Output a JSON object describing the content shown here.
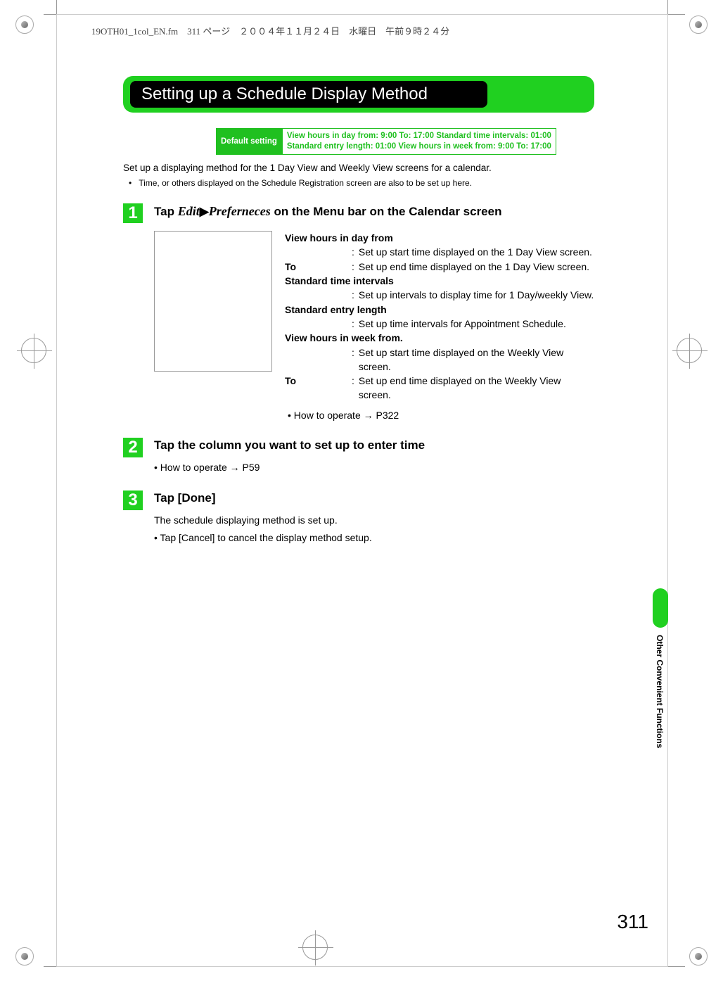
{
  "runhead": "19OTH01_1col_EN.fm　311 ページ　２００４年１１月２４日　水曜日　午前９時２４分",
  "title": "Setting up a Schedule Display Method",
  "default_setting": {
    "label": "Default setting",
    "value_line1": "View hours in day from: 9:00 To: 17:00 Standard time intervals: 01:00",
    "value_line2": "Standard entry length: 01:00 View hours in week from: 9:00 To: 17:00"
  },
  "intro": "Set up a displaying method for the 1 Day View and Weekly View screens for a calendar.",
  "intro_bullet": "Time, or others displayed on the Schedule Registration screen are also to be set up here.",
  "steps": {
    "s1": {
      "num": "1",
      "title_pre": "Tap ",
      "title_edit": "Edit",
      "title_arrow": "▶",
      "title_pref": "Preferneces",
      "title_post": " on the Menu bar on the Calendar screen",
      "defs": {
        "d1": {
          "label": "View hours in day from",
          "desc": "Set up start time displayed on the 1 Day View screen."
        },
        "d2": {
          "label": "To",
          "desc": "Set up end time displayed on the 1 Day View screen."
        },
        "d3": {
          "label": "Standard time intervals",
          "desc": "Set up intervals to display time for 1 Day/weekly View."
        },
        "d4": {
          "label": "Standard entry length",
          "desc": "Set up time intervals for Appointment Schedule."
        },
        "d5": {
          "label": "View hours in week from.",
          "desc": "Set up start time displayed on the Weekly View screen."
        },
        "d6": {
          "label": "To",
          "desc": "Set up end time displayed on the Weekly View screen."
        }
      },
      "howto": "•   How to operate → P322"
    },
    "s2": {
      "num": "2",
      "title": "Tap the column you want to set up to enter time",
      "howto": "•   How to operate → P59"
    },
    "s3": {
      "num": "3",
      "title": "Tap [Done]",
      "text": "The schedule displaying method is set up.",
      "bullet": "•   Tap [Cancel] to cancel the display method setup."
    }
  },
  "side_tab": "Other Convenient Functions",
  "page_number": "311"
}
